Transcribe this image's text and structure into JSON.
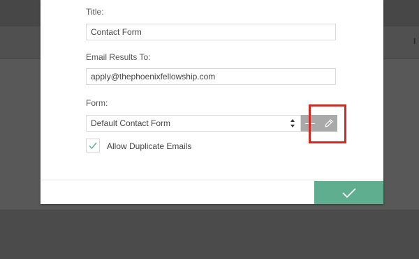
{
  "background": {
    "letters": [
      "t",
      "I"
    ]
  },
  "form": {
    "title_label": "Title:",
    "title_value": "Contact Form",
    "email_label": "Email Results To:",
    "email_value": "apply@thephoenixfellowship.com",
    "form_label": "Form:",
    "form_selected": "Default Contact Form",
    "remove_symbol": "—",
    "allow_duplicates_label": "Allow Duplicate Emails",
    "allow_duplicates_checked": true
  },
  "colors": {
    "accent": "#5fae8f",
    "highlight": "#d22a23",
    "button_gray": "#a9a9a9"
  },
  "icons": {
    "edit": "pencil-icon",
    "confirm": "checkmark-icon",
    "checkbox": "checkmark-icon"
  }
}
